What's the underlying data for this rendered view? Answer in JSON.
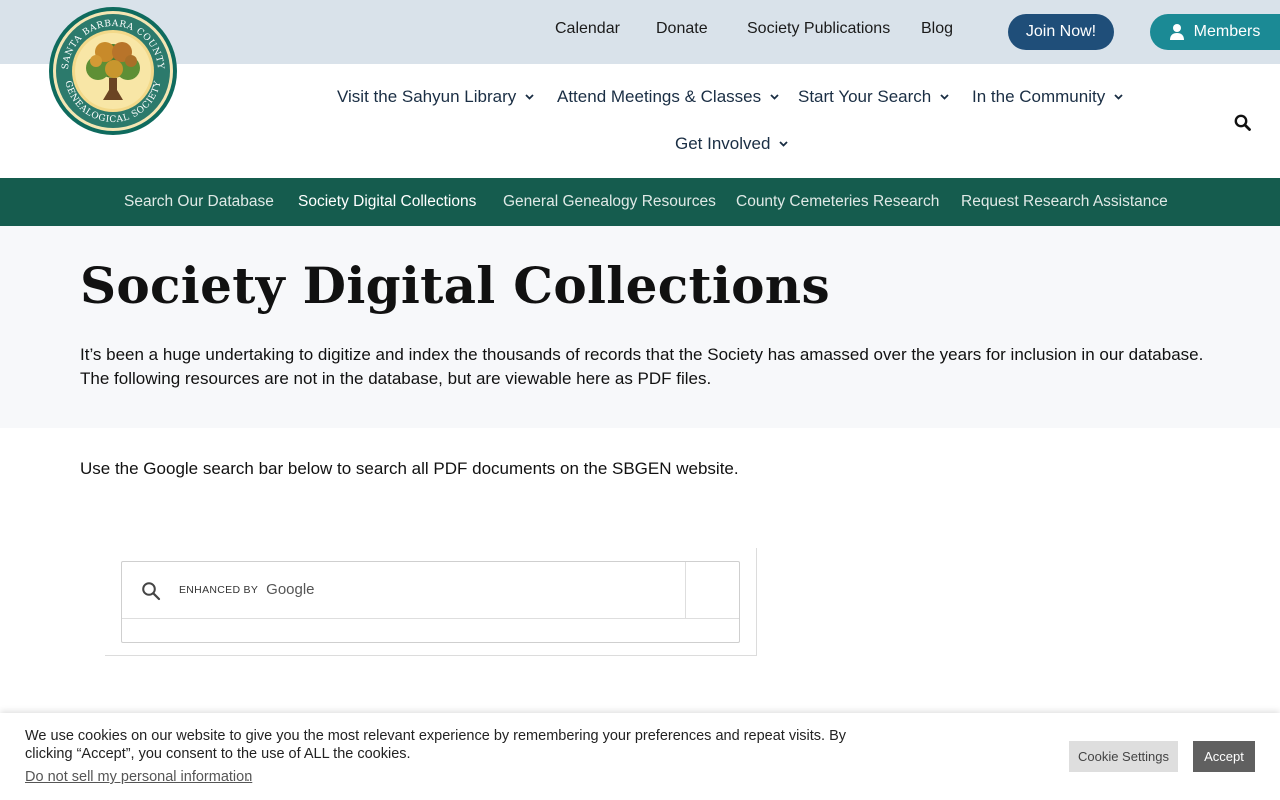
{
  "logo": {
    "text_top": "SANTA BARBARA COUNTY",
    "text_bottom": "GENEALOGICAL SOCIETY"
  },
  "topbar": {
    "links": [
      "Calendar",
      "Donate",
      "Society Publications",
      "Blog"
    ],
    "join_label": "Join Now!",
    "members_label": "Members"
  },
  "mainnav": {
    "items": [
      "Visit the Sahyun Library",
      "Attend Meetings & Classes",
      "Start Your Search",
      "In the Community",
      "Get Involved"
    ]
  },
  "subnav": {
    "items": [
      "Search Our Database",
      "Society Digital Collections",
      "General Genealogy Resources",
      "County Cemeteries Research",
      "Request Research Assistance"
    ],
    "active": "Society Digital Collections"
  },
  "hero": {
    "title": "Society Digital Collections",
    "intro": "It’s been a huge undertaking to digitize and index the thousands of records that the Society has amassed over the years for inclusion in our database. The following resources are not in the database, but are viewable here as PDF files."
  },
  "main": {
    "search_note": "Use the Google search bar below to search all PDF documents on the SBGEN website."
  },
  "cse": {
    "enhanced_by": "ENHANCED BY",
    "google": "Google",
    "query": ""
  },
  "cookie": {
    "text": "We use cookies on our website to give you the most relevant experience by remembering your preferences and repeat visits. By clicking “Accept”, you consent to the use of ALL the cookies.",
    "do_not_sell": "Do not sell my personal information",
    "settings_label": "Cookie Settings",
    "accept_label": "Accept"
  },
  "colors": {
    "topbar_bg": "#d9e2ea",
    "join_button": "#1f4e79",
    "members_button": "#1b8a95",
    "subnav_bg": "#155c4e",
    "hero_bg": "#f7f8fa"
  }
}
